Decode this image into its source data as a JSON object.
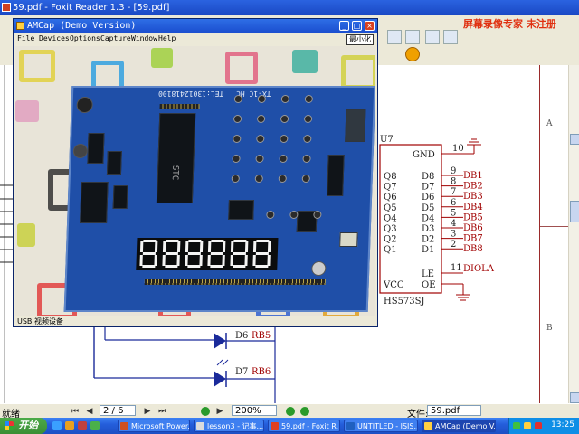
{
  "foxit": {
    "title": "59.pdf - Foxit Reader 1.3 - [59.pdf]",
    "watermark": "屏幕录像专家 未注册",
    "statusbar": {
      "status": "就绪",
      "page": "2 / 6",
      "zoom": "200%",
      "file_label": "文件:",
      "file_name": "59.pdf"
    },
    "zones": {
      "a": "A",
      "b": "B"
    }
  },
  "schematic": {
    "ref": "U7",
    "part": "HS573SJ",
    "left_pins": [
      "Q8",
      "Q7",
      "Q6",
      "Q5",
      "Q4",
      "Q3",
      "Q2",
      "Q1"
    ],
    "right_pins": [
      "D8",
      "D7",
      "D6",
      "D5",
      "D4",
      "D3",
      "D2",
      "D1"
    ],
    "pin_numbers": [
      "9",
      "8",
      "7",
      "6",
      "5",
      "4",
      "3",
      "2"
    ],
    "nets": [
      "DB1",
      "DB2",
      "DB3",
      "DB4",
      "DB5",
      "DB6",
      "DB7",
      "DB8"
    ],
    "gnd": {
      "label": "GND",
      "pin": "10"
    },
    "vcc": "VCC",
    "le": "LE",
    "oe": "OE",
    "le_pin": "11",
    "le_net": "DIOLA",
    "diodes": [
      {
        "ref": "D6",
        "net": "RB5"
      },
      {
        "ref": "D7",
        "net": "RB6"
      }
    ]
  },
  "amcap": {
    "title": "AMCap (Demo Version)",
    "menu": [
      "File",
      "Devices",
      "Options",
      "Capture",
      "Window",
      "Help"
    ],
    "min_hint": "最小化",
    "status": "USB 视频设备",
    "board": {
      "silk_tel": "TEL:13012418100",
      "silk_model": "TX-1C HC",
      "chip_label": "STC",
      "seven_seg": "888888"
    }
  },
  "taskbar": {
    "start": "开始",
    "tasks": [
      "Microsoft Power...",
      "lesson3 - 记事...",
      "59.pdf - Foxit R...",
      "UNTITLED - ISIS...",
      "AMCap (Demo V..."
    ],
    "clock": "13:25"
  }
}
